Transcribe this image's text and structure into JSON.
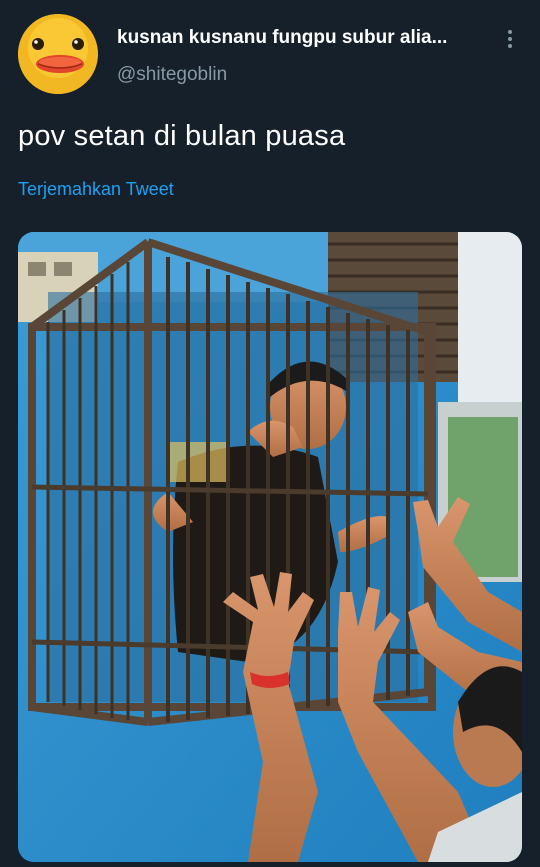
{
  "tweet": {
    "display_name": "kusnan kusnanu fungpu subur alia...",
    "handle": "@shitegoblin",
    "text": "pov setan di bulan puasa",
    "translate_label": "Terjemahkan Tweet"
  },
  "icons": {
    "avatar": "duck-avatar",
    "more": "more-vertical-icon"
  },
  "colors": {
    "background": "#15202b",
    "primary_text": "#ffffff",
    "secondary_text": "#8899a6",
    "link": "#1da1f2"
  }
}
